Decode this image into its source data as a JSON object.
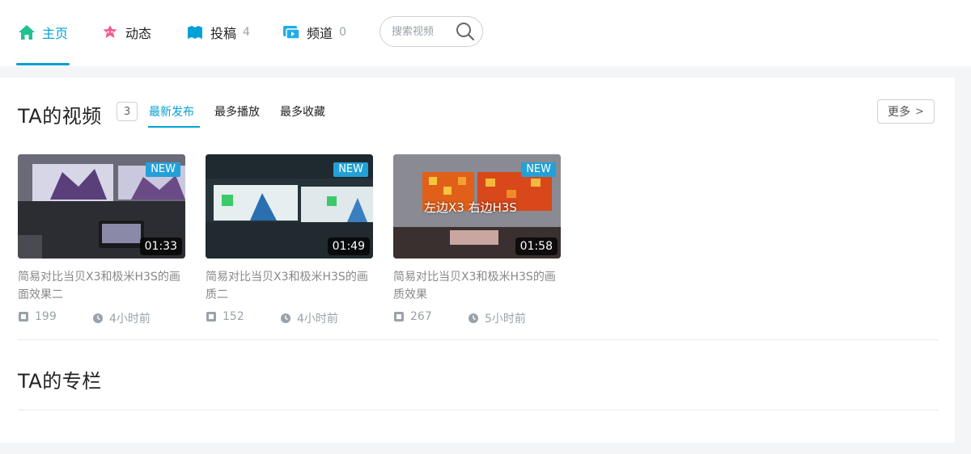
{
  "nav": {
    "items": [
      {
        "label": "主页",
        "count": ""
      },
      {
        "label": "动态",
        "count": ""
      },
      {
        "label": "投稿",
        "count": "4"
      },
      {
        "label": "频道",
        "count": "0"
      }
    ],
    "search": {
      "placeholder": "搜索视频"
    }
  },
  "colors": {
    "accent": "#00a1d6",
    "badge": "#23a0d7",
    "home_icon": "#1fc28f",
    "dynamic_icon": "#f25d8e"
  },
  "videos_section": {
    "title": "TA的视频",
    "count": "3",
    "sort_tabs": [
      "最新发布",
      "最多播放",
      "最多收藏"
    ],
    "more_label": "更多"
  },
  "videos": [
    {
      "badge": "NEW",
      "duration": "01:33",
      "title": "简易对比当贝X3和极米H3S的画面效果二",
      "plays": "199",
      "time": "4小时前",
      "overlay": ""
    },
    {
      "badge": "NEW",
      "duration": "01:49",
      "title": "简易对比当贝X3和极米H3S的画质二",
      "plays": "152",
      "time": "4小时前",
      "overlay": ""
    },
    {
      "badge": "NEW",
      "duration": "01:58",
      "title": "简易对比当贝X3和极米H3S的画质效果",
      "plays": "267",
      "time": "5小时前",
      "overlay": "左边X3 右边H3S"
    }
  ],
  "columns_section": {
    "title": "TA的专栏"
  }
}
